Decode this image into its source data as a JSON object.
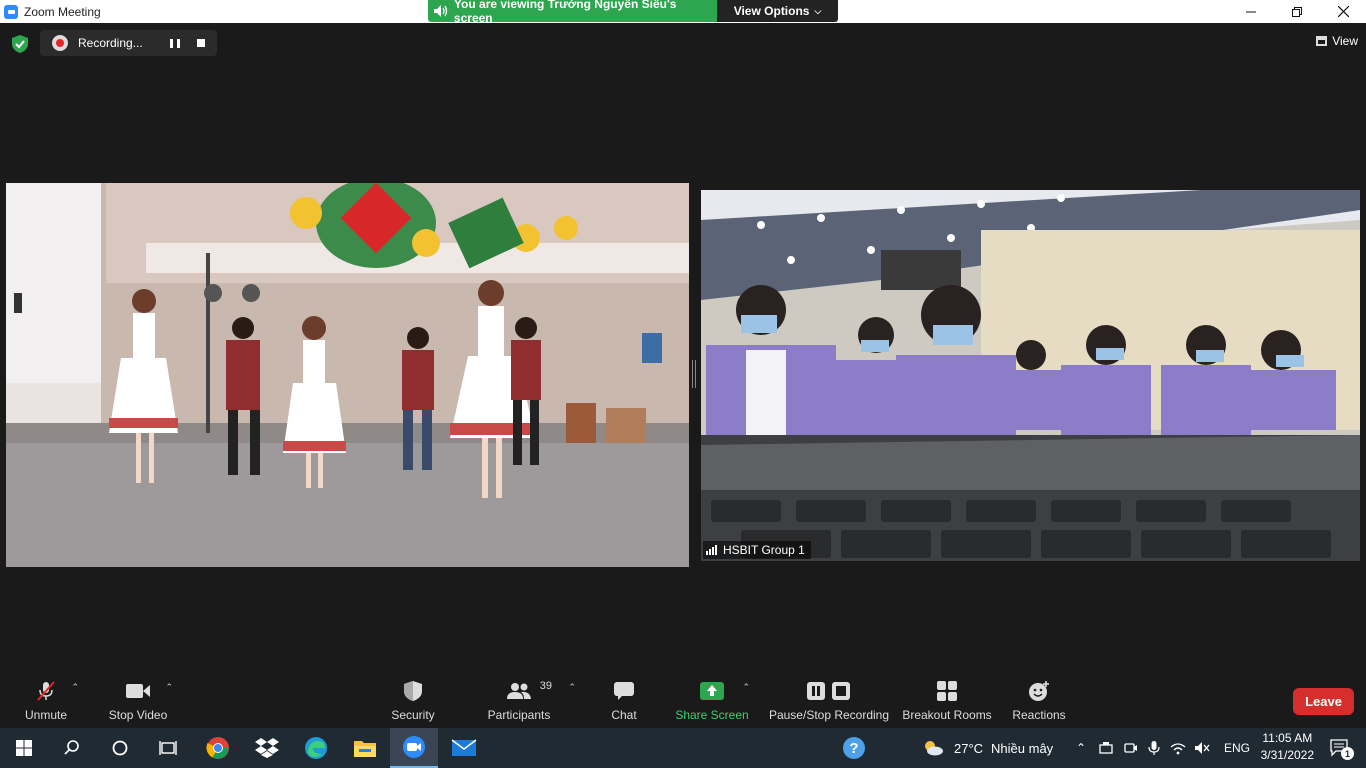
{
  "window": {
    "title": "Zoom Meeting"
  },
  "share_banner": {
    "message": "You are viewing Trường Nguyễn Siêu's screen",
    "view_options": "View Options"
  },
  "recording": {
    "status": "Recording..."
  },
  "view_button": {
    "label": "View"
  },
  "videos": [
    {
      "participant": "",
      "scene": "dance"
    },
    {
      "participant": "HSBIT Group 1",
      "scene": "classroom"
    }
  ],
  "toolbar": {
    "unmute": "Unmute",
    "stop_video": "Stop Video",
    "security": "Security",
    "participants": "Participants",
    "participants_count": "39",
    "chat": "Chat",
    "share_screen": "Share Screen",
    "pause_stop_recording": "Pause/Stop Recording",
    "breakout_rooms": "Breakout Rooms",
    "reactions": "Reactions",
    "leave": "Leave"
  },
  "taskbar": {
    "weather_temp": "27°C",
    "weather_desc": "Nhiều mây",
    "language": "ENG",
    "time": "11:05 AM",
    "date": "3/31/2022",
    "notification_count": "1"
  },
  "colors": {
    "accent": "#2d8cff",
    "share_green": "#2ea54f",
    "leave_red": "#d62d2d",
    "share_label": "#3bd16f"
  }
}
